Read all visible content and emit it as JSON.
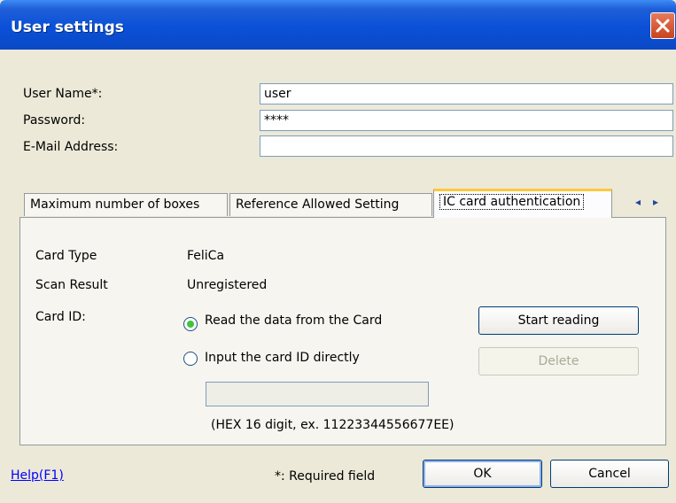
{
  "window": {
    "title": "User settings"
  },
  "form": {
    "user_name_label": "User Name*:",
    "user_name_value": "user",
    "password_label": "Password:",
    "password_value": "****",
    "email_label": "E-Mail Address:",
    "email_value": ""
  },
  "tabs": [
    {
      "label": "Maximum number of boxes"
    },
    {
      "label": "Reference Allowed Setting"
    },
    {
      "label": "IC card authentication"
    }
  ],
  "tab_scroll": {
    "left": "◂",
    "right": "▸"
  },
  "ic_card": {
    "card_type_label": "Card Type",
    "card_type_value": "FeliCa",
    "scan_result_label": "Scan Result",
    "scan_result_value": "Unregistered",
    "card_id_label": "Card ID:",
    "radio_read_label": "Read the data from the Card",
    "radio_read_selected": true,
    "radio_input_label": "Input the card ID directly",
    "radio_input_selected": false,
    "start_reading_label": "Start reading",
    "delete_label": "Delete",
    "card_id_value": "",
    "hex_hint": "(HEX 16 digit, ex. 11223344556677EE)"
  },
  "footer": {
    "help_label": "Help(F1)",
    "required_note": "*: Required field",
    "ok_label": "OK",
    "cancel_label": "Cancel"
  },
  "colors": {
    "titlebar": "#0a50d8",
    "close": "#c8431c",
    "active_tab_accent": "#ffc83c",
    "radio_dot": "#3ec43e"
  }
}
